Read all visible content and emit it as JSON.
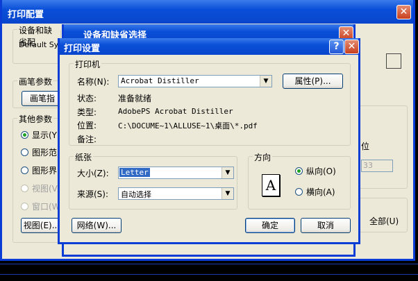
{
  "outer_window": {
    "title": "打印配置",
    "device_group_label": "设备和缺省配",
    "default_system_text": "Default Syst",
    "pen_group_label": "画笔参数",
    "pen_button": "画笔指",
    "other_group_label": "其他参数",
    "radios": [
      {
        "label": "显示(Y)",
        "checked": true,
        "disabled": false
      },
      {
        "label": "图形范围",
        "checked": false,
        "disabled": false
      },
      {
        "label": "图形界限",
        "checked": false,
        "disabled": false
      },
      {
        "label": "视图(V)",
        "checked": false,
        "disabled": true
      },
      {
        "label": "窗口(W)",
        "checked": false,
        "disabled": true
      }
    ],
    "view_button": "视图(E)...",
    "right_partial_label": "位",
    "right_partial_value": "33",
    "all_label": "全部(U)"
  },
  "middle_window": {
    "title": "设备和缺省选择"
  },
  "dialog": {
    "title": "打印设置",
    "help_glyph": "?",
    "close_glyph": "✕",
    "printer_group": "打印机",
    "name_label": "名称(N):",
    "name_value": "Acrobat Distiller",
    "properties_button": "属性(P)...",
    "status_label": "状态:",
    "status_value": "准备就绪",
    "type_label": "类型:",
    "type_value": "AdobePS Acrobat Distiller",
    "location_label": "位置:",
    "location_value": "C:\\DOCUME~1\\ALLUSE~1\\桌面\\*.pdf",
    "comment_label": "备注:",
    "comment_value": "",
    "paper_group": "纸张",
    "size_label": "大小(Z):",
    "size_value": "Letter",
    "source_label": "来源(S):",
    "source_value": "自动选择",
    "orientation_group": "方向",
    "portrait_label": "纵向(O)",
    "landscape_label": "横向(A)",
    "orientation_selected": "portrait",
    "page_icon_letter": "A",
    "network_button": "网络(W)...",
    "ok_button": "确定",
    "cancel_button": "取消"
  },
  "icons": {
    "close": "close-icon",
    "help": "help-icon",
    "dropdown": "chevron-down-icon",
    "page": "portrait-page-icon"
  },
  "colors": {
    "title_bar": "#0a4fd8",
    "dialog_face": "#ece9d8",
    "close_button": "#c8401e",
    "selection": "#316ac5",
    "cad_background": "#000000"
  }
}
